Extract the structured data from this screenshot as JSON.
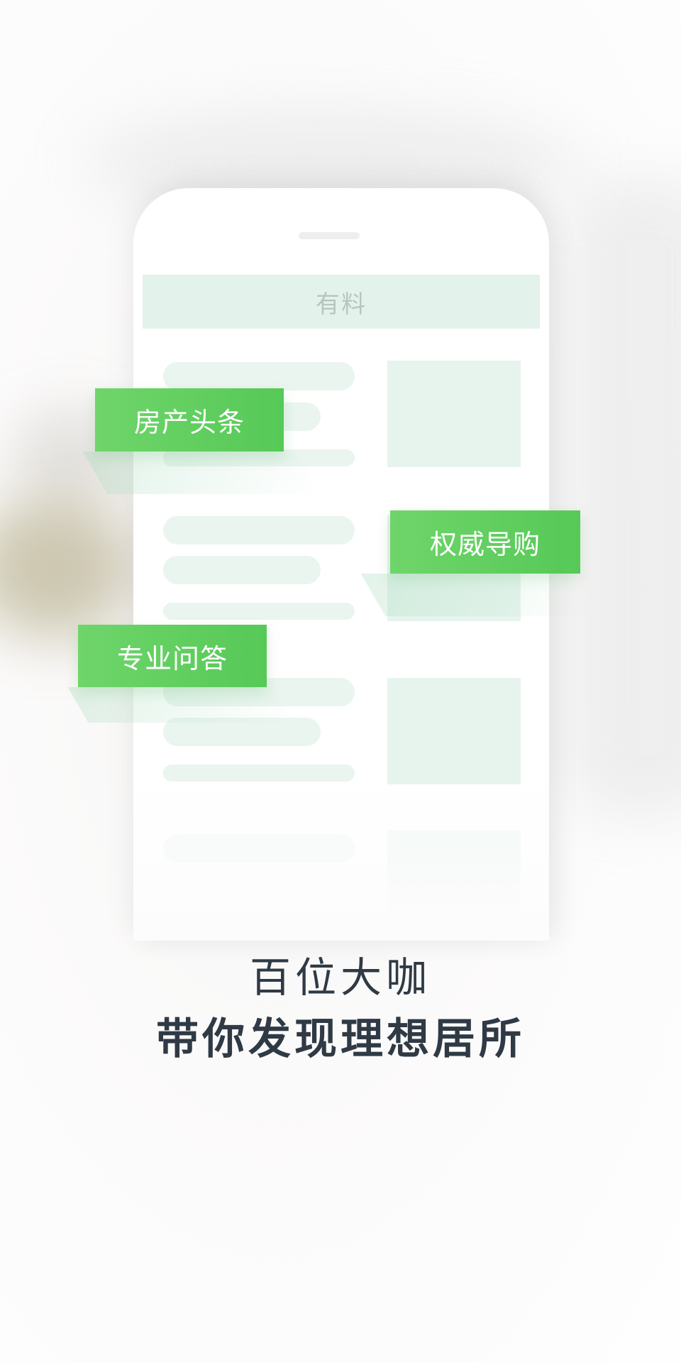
{
  "phone": {
    "header_title": "有料"
  },
  "tags": {
    "real_estate_headlines": "房产头条",
    "authoritative_guide": "权威导购",
    "professional_qa": "专业问答"
  },
  "tagline": {
    "line1": "百位大咖",
    "line2": "带你发现理想居所"
  },
  "colors": {
    "tag_green": "#5ecf5f",
    "placeholder_mint": "#e6f4ed",
    "text_dark": "#2f3a45"
  }
}
